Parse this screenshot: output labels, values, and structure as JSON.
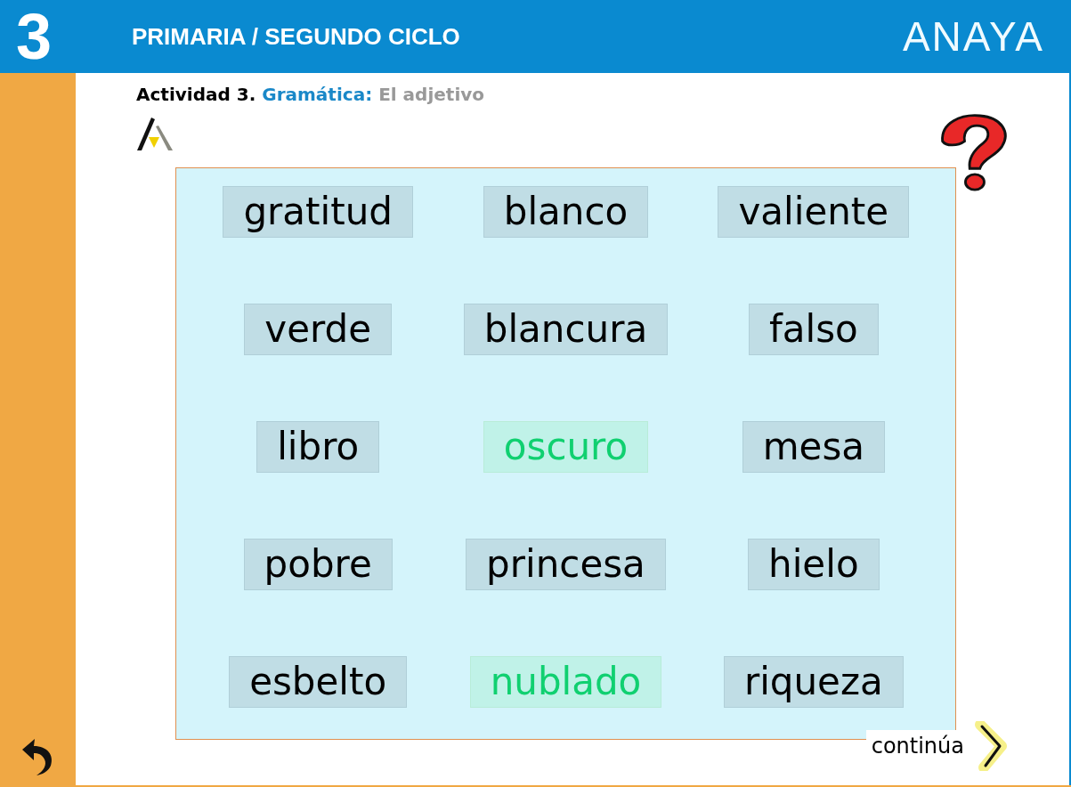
{
  "header": {
    "level_number": "3",
    "title": "PRIMARIA / SEGUNDO CICLO",
    "brand": "ANAYA"
  },
  "heading": {
    "activity": "Actividad 3.",
    "section": "Gramática:",
    "topic": "El adjetivo"
  },
  "words": [
    {
      "text": "gratitud",
      "selected": false
    },
    {
      "text": "blanco",
      "selected": false
    },
    {
      "text": "valiente",
      "selected": false
    },
    {
      "text": "verde",
      "selected": false
    },
    {
      "text": "blancura",
      "selected": false
    },
    {
      "text": "falso",
      "selected": false
    },
    {
      "text": "libro",
      "selected": false
    },
    {
      "text": "oscuro",
      "selected": true
    },
    {
      "text": "mesa",
      "selected": false
    },
    {
      "text": "pobre",
      "selected": false
    },
    {
      "text": "princesa",
      "selected": false
    },
    {
      "text": "hielo",
      "selected": false
    },
    {
      "text": "esbelto",
      "selected": false
    },
    {
      "text": "nublado",
      "selected": true
    },
    {
      "text": "riqueza",
      "selected": false
    }
  ],
  "continue_label": "continúa"
}
